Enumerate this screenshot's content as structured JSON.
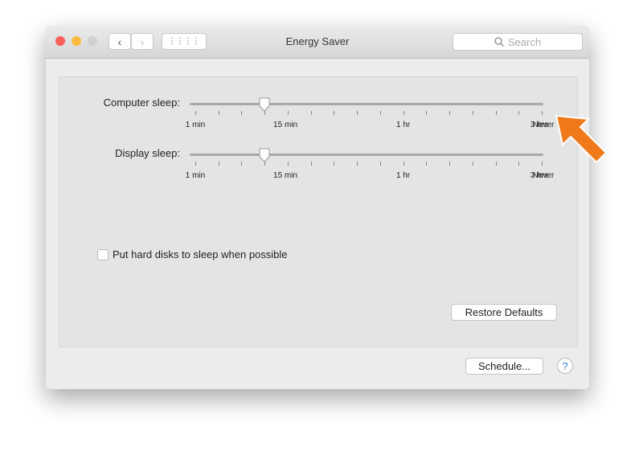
{
  "window": {
    "title": "Energy Saver",
    "search_placeholder": "Search",
    "back_icon": "chevron-left-icon",
    "forward_icon": "chevron-right-icon",
    "grid_icon": "grid-icon"
  },
  "traffic_lights": {
    "close": "#fc605b",
    "minimize": "#fdbc40",
    "zoom": "#d0d0d0"
  },
  "sliders": [
    {
      "label": "Computer sleep:",
      "tick_labels": [
        "1 min",
        "15 min",
        "1 hr",
        "3 hrs",
        "Never"
      ],
      "tick_count": 16,
      "value_tick_index": 3
    },
    {
      "label": "Display sleep:",
      "tick_labels": [
        "1 min",
        "15 min",
        "1 hr",
        "3 hrs",
        "Never"
      ],
      "tick_count": 16,
      "value_tick_index": 3
    }
  ],
  "checkbox": {
    "label": "Put hard disks to sleep when possible",
    "checked": false
  },
  "buttons": {
    "restore": "Restore Defaults",
    "schedule": "Schedule...",
    "help": "?"
  },
  "annotation": {
    "arrow_color": "#f07a1a"
  }
}
